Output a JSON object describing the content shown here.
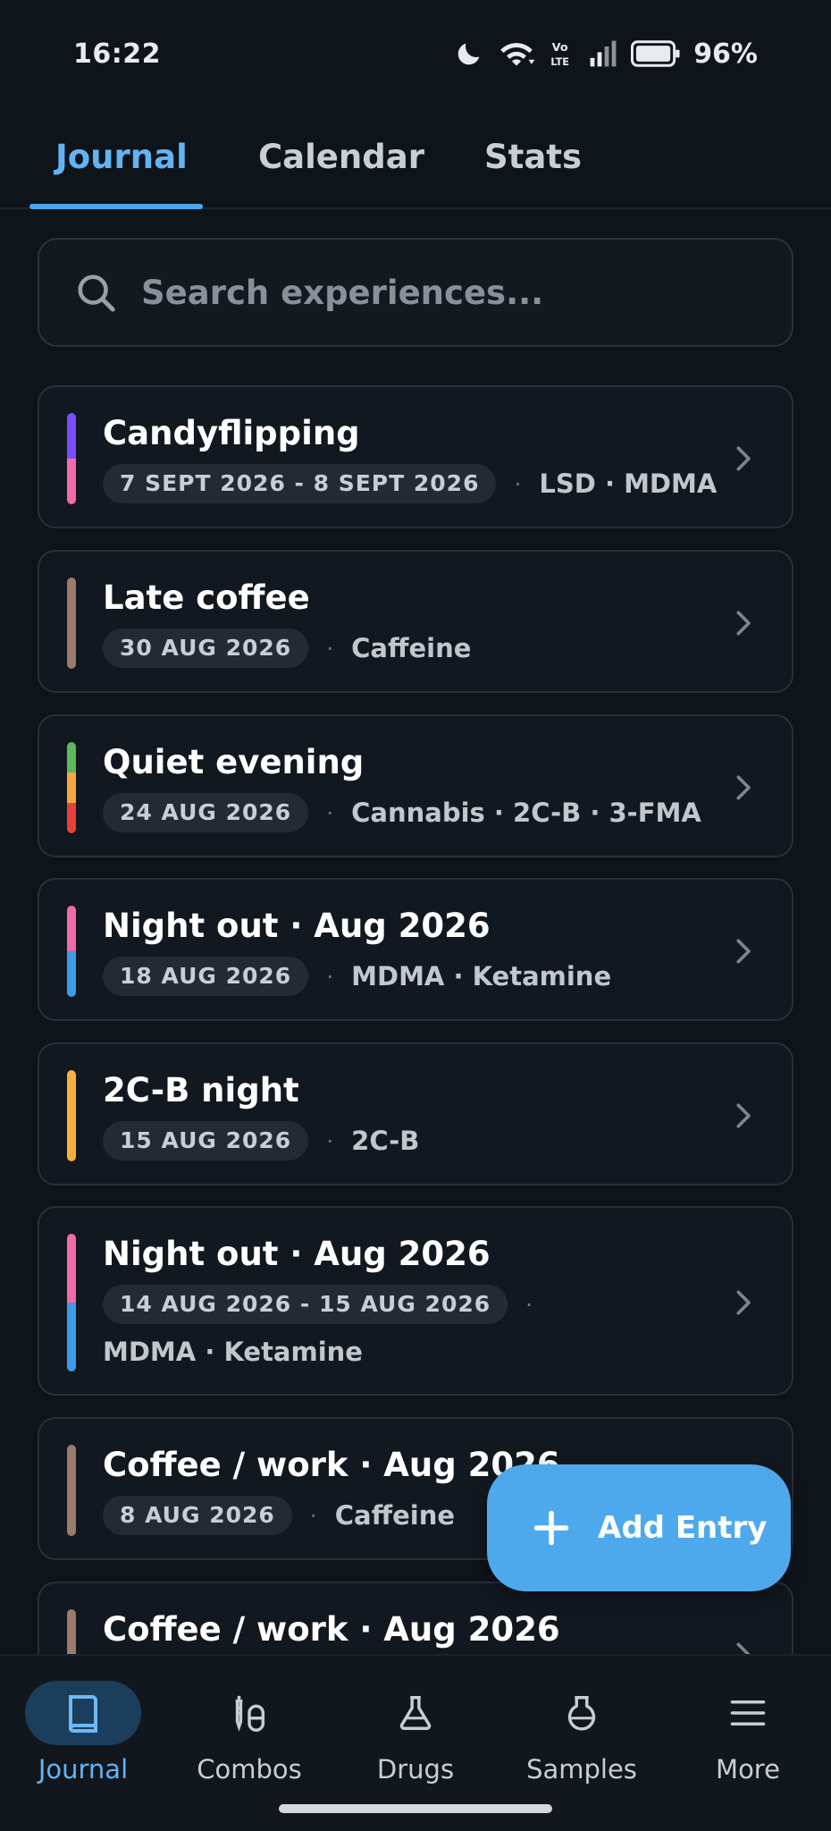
{
  "status": {
    "time": "16:22",
    "battery": "96%",
    "icons": [
      "moon-icon",
      "wifi-icon",
      "volte-icon",
      "signal-icon",
      "battery-icon"
    ]
  },
  "tabs": [
    {
      "label": "Journal",
      "active": true
    },
    {
      "label": "Calendar",
      "active": false
    },
    {
      "label": "Stats",
      "active": false
    }
  ],
  "search": {
    "placeholder": "Search experiences..."
  },
  "entries": [
    {
      "title": "Candyflipping",
      "date": "7 SEPT 2026 - 8 SEPT 2026",
      "substances": "LSD · MDMA",
      "colors": [
        "#7c4dff",
        "#f06ba8"
      ]
    },
    {
      "title": "Late coffee",
      "date": "30 AUG 2026",
      "substances": "Caffeine",
      "colors": [
        "#9a7b6c"
      ]
    },
    {
      "title": "Quiet evening",
      "date": "24 AUG 2026",
      "substances": "Cannabis · 2C-B · 3-FMA",
      "colors": [
        "#5cb85c",
        "#f5a742",
        "#e8413d"
      ]
    },
    {
      "title": "Night out · Aug 2026",
      "date": "18 AUG 2026",
      "substances": "MDMA · Ketamine",
      "colors": [
        "#f06ba8",
        "#3d9be9"
      ]
    },
    {
      "title": "2C-B night",
      "date": "15 AUG 2026",
      "substances": "2C-B",
      "colors": [
        "#f5b03f"
      ]
    },
    {
      "title": "Night out · Aug 2026",
      "date": "14 AUG 2026 - 15 AUG 2026",
      "substances": "MDMA · Ketamine",
      "colors": [
        "#f06ba8",
        "#3d9be9"
      ]
    },
    {
      "title": "Coffee / work · Aug 2026",
      "date": "8 AUG 2026",
      "substances": "Caffeine",
      "colors": [
        "#9a7b6c"
      ]
    },
    {
      "title": "Coffee / work · Aug 2026",
      "colors": [
        "#9a7b6c"
      ]
    }
  ],
  "fab": {
    "label": "Add Entry"
  },
  "bottom_nav": [
    {
      "label": "Journal",
      "icon": "book-icon",
      "active": true
    },
    {
      "label": "Combos",
      "icon": "syringe-pill-icon",
      "active": false
    },
    {
      "label": "Drugs",
      "icon": "flask-icon",
      "active": false
    },
    {
      "label": "Samples",
      "icon": "beaker-icon",
      "active": false
    },
    {
      "label": "More",
      "icon": "menu-icon",
      "active": false
    }
  ]
}
